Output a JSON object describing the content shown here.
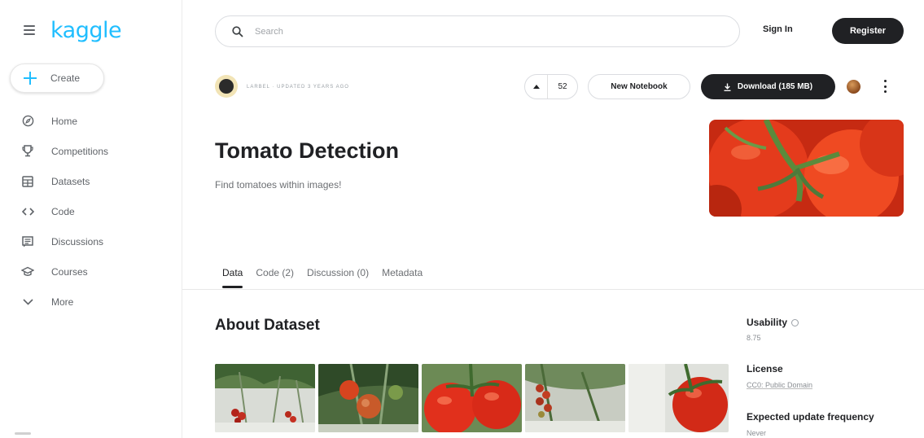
{
  "brand": {
    "logo_text": "kaggle",
    "accent": "#20beff"
  },
  "sidebar": {
    "create_label": "Create",
    "items": [
      {
        "label": "Home",
        "icon": "home-icon"
      },
      {
        "label": "Competitions",
        "icon": "trophy-icon"
      },
      {
        "label": "Datasets",
        "icon": "table-icon"
      },
      {
        "label": "Code",
        "icon": "code-icon"
      },
      {
        "label": "Discussions",
        "icon": "discussions-icon"
      },
      {
        "label": "Courses",
        "icon": "school-icon"
      },
      {
        "label": "More",
        "icon": "chevron-down-icon"
      }
    ]
  },
  "header": {
    "search_placeholder": "Search",
    "sign_in_label": "Sign In",
    "register_label": "Register"
  },
  "dataset": {
    "meta_text": "LARBEL · UPDATED 3 YEARS AGO",
    "vote_count": "52",
    "new_notebook_label": "New Notebook",
    "download_label": "Download (185 MB)",
    "title": "Tomato Detection",
    "subtitle": "Find tomatoes within images!"
  },
  "tabs": [
    {
      "label": "Data",
      "active": true
    },
    {
      "label": "Code (2)",
      "active": false
    },
    {
      "label": "Discussion (0)",
      "active": false
    },
    {
      "label": "Metadata",
      "active": false
    }
  ],
  "about": {
    "heading": "About Dataset"
  },
  "side_panel": {
    "usability_label": "Usability",
    "usability_value": "8.75",
    "license_label": "License",
    "license_value": "CC0: Public Domain",
    "update_label": "Expected update frequency",
    "update_value": "Never"
  },
  "colors": {
    "dark_button": "#202124",
    "tomato_red": "#e8321c",
    "stem_green": "#4f7a3a"
  }
}
